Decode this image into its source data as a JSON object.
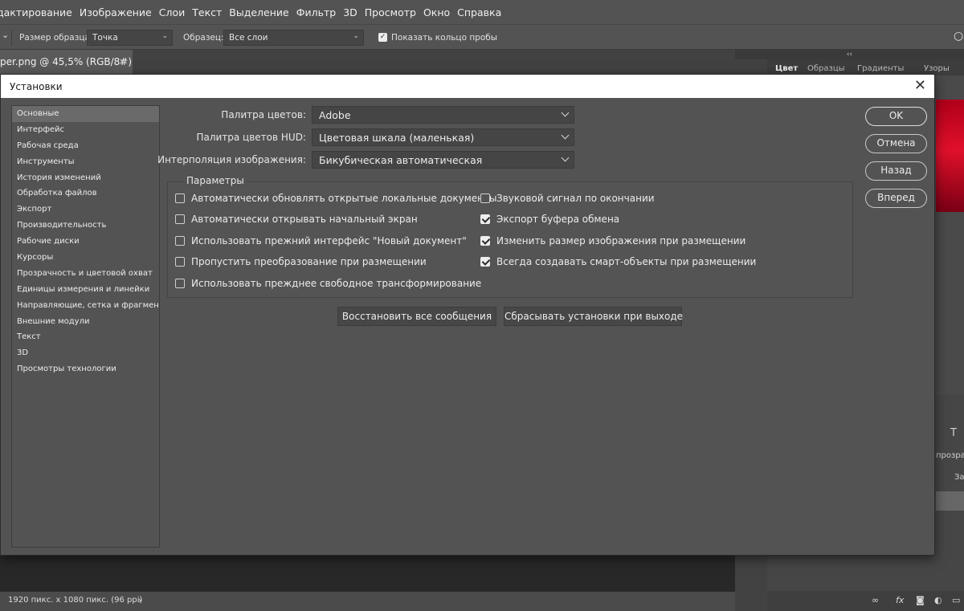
{
  "app": {
    "menu": [
      "дактирование",
      "Изображение",
      "Слои",
      "Текст",
      "Выделение",
      "Фильтр",
      "3D",
      "Просмотр",
      "Окно",
      "Справка"
    ],
    "options_bar": {
      "sample_size_label": "Размер образца:",
      "sample_size_value": "Точка",
      "sample_label": "Образец:",
      "sample_value": "Все слои",
      "show_ring_label": "Показать кольцо пробы",
      "show_ring_checked": true
    },
    "doc_tab": {
      "title": "per.png @ 45,5% (RGB/8#) *",
      "close": "×"
    },
    "status": {
      "text": "1920 пикс. x 1080 пикс. (96 ppi)",
      "arrow": "›"
    },
    "right_panel": {
      "collapse": "‹‹",
      "tabs": [
        "Цвет",
        "Образцы",
        "Градиенты",
        "Узоры"
      ],
      "layers_row_1": "прозрач",
      "layers_row_2": "За",
      "text_icon": "T",
      "bottom_fx": "fx"
    }
  },
  "dialog": {
    "title": "Установки",
    "sidebar": [
      "Основные",
      "Интерфейс",
      "Рабочая среда",
      "Инструменты",
      "История изменений",
      "Обработка файлов",
      "Экспорт",
      "Производительность",
      "Рабочие диски",
      "Курсоры",
      "Прозрачность и цветовой охват",
      "Единицы измерения и линейки",
      "Направляющие, сетка и фрагменты",
      "Внешние модули",
      "Текст",
      "3D",
      "Просмотры технологии"
    ],
    "selected_sidebar_index": 0,
    "fields": {
      "color_picker_label": "Палитра цветов:",
      "color_picker_value": "Adobe",
      "hud_picker_label": "Палитра цветов HUD:",
      "hud_picker_value": "Цветовая шкала (маленькая)",
      "interpolation_label": "Интерполяция изображения:",
      "interpolation_value": "Бикубическая автоматическая"
    },
    "options_group": {
      "title": "Параметры",
      "left": [
        {
          "label": "Автоматически обновлять открытые локальные документы",
          "checked": false
        },
        {
          "label": "Автоматически открывать начальный экран",
          "checked": false
        },
        {
          "label": "Использовать прежний интерфейс \"Новый документ\"",
          "checked": false
        },
        {
          "label": "Пропустить преобразование при размещении",
          "checked": false
        },
        {
          "label": "Использовать прежднее свободное трансформирование",
          "checked": false
        }
      ],
      "right": [
        {
          "label": "Звуковой сигнал по окончании",
          "checked": false
        },
        {
          "label": "Экспорт буфера обмена",
          "checked": true
        },
        {
          "label": "Изменить размер изображения при размещении",
          "checked": true
        },
        {
          "label": "Всегда создавать смарт-объекты при размещении",
          "checked": true
        }
      ]
    },
    "buttons": {
      "restore_messages": "Восстановить все сообщения",
      "reset_on_exit": "Сбрасывать установки при выходе",
      "ok": "OK",
      "cancel": "Отмена",
      "back": "Назад",
      "forward": "Вперед"
    }
  }
}
